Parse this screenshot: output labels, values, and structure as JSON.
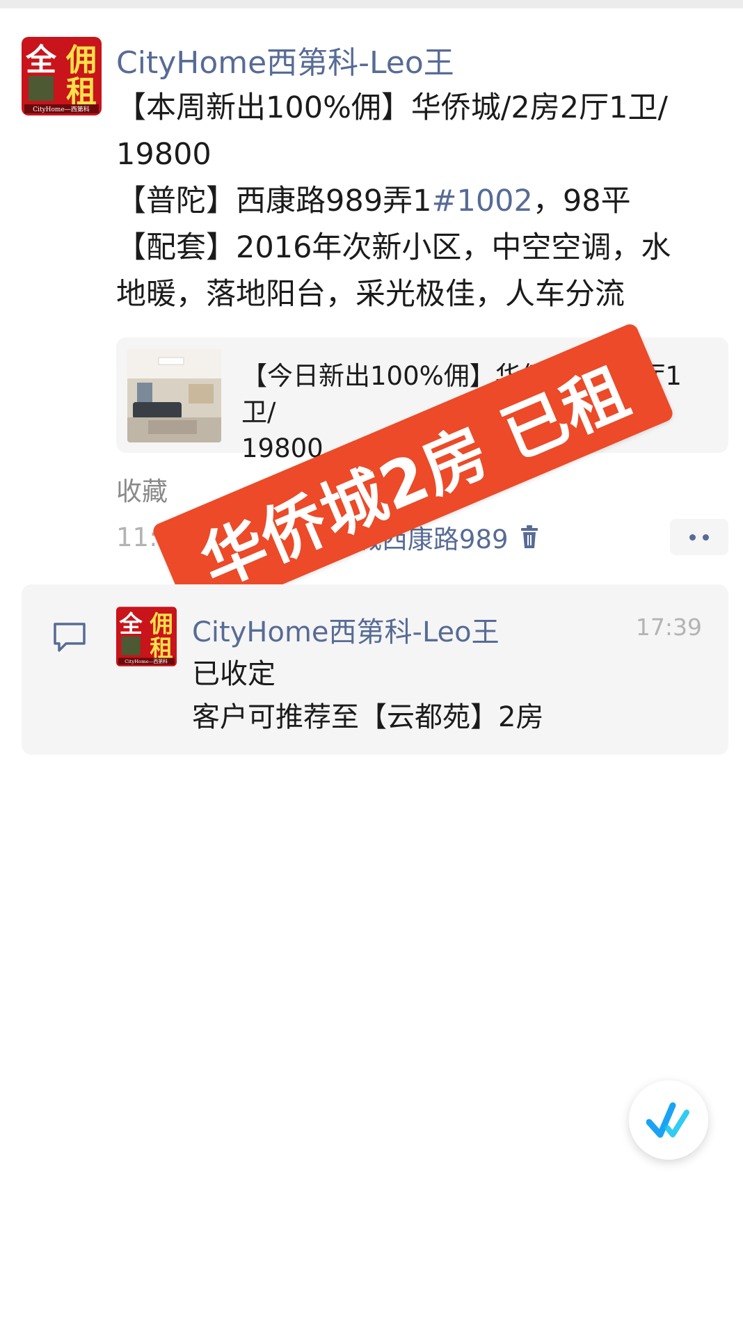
{
  "post": {
    "avatar_text_1": "全",
    "avatar_text_2": "佣",
    "avatar_text_3": "租",
    "avatar_caption": "CityHome—西第科",
    "author": "CityHome西第科-Leo王",
    "line1": "【本周新出100%佣】华侨城/2房2厅1卫/",
    "line2": "19800",
    "line3_prefix": "【普陀】西康路989弄1",
    "line3_hash": "#1002",
    "line3_suffix": "，98平",
    "line4": "【配套】2016年次新小区，中空空调，水",
    "line5": "地暖，落地阳台，采光极佳，人车分流",
    "link_card": {
      "title": "【今日新出100%佣】华侨城/2房2厅1卫/",
      "title_line2": "19800",
      "thumb_icon": "room-photo"
    },
    "favorite_label": "收藏",
    "time": "11:25",
    "location": "上海市 · 华侨城西康路989",
    "more_icon": "more-dots-icon"
  },
  "stamp": {
    "text": "华侨城2房 已租",
    "color": "#ec4a28"
  },
  "comment": {
    "icon": "comment-bubble-icon",
    "author": "CityHome西第科-Leo王",
    "time": "17:39",
    "line1": "已收定",
    "line2": "客户可推荐至【云都苑】2房"
  },
  "colors": {
    "link": "#576b95",
    "accent": "#ec4a28",
    "fab_check": "#1aa3f5"
  },
  "fab": {
    "icon": "check-mark-icon"
  }
}
